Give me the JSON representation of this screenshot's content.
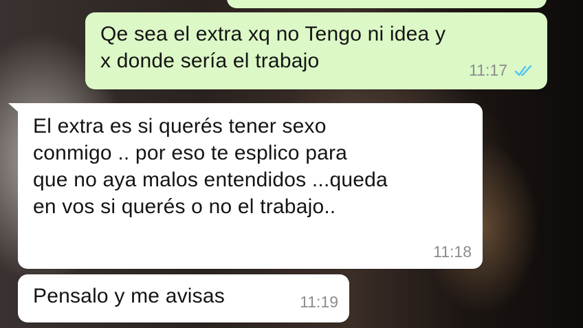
{
  "conversation": {
    "messages": [
      {
        "direction": "outgoing",
        "text": "",
        "time": ""
      },
      {
        "direction": "outgoing",
        "text": "Qe sea el extra xq no Tengo ni idea y\nx donde sería el trabajo",
        "time": "11:17",
        "status_icon": "double-check-read-icon",
        "status_color": "#4fc3f7"
      },
      {
        "direction": "incoming",
        "text": "El extra es si querés tener sexo\nconmigo .. por eso te esplico para\nque no aya malos entendidos ...queda\nen vos si querés o no el trabajo..",
        "time": "11:18"
      },
      {
        "direction": "incoming",
        "text": "Pensalo y me avisas",
        "time": "11:19"
      }
    ]
  },
  "colors": {
    "outgoing_bubble": "#dcf8c6",
    "incoming_bubble": "#ffffff",
    "timestamp": "#8c8c8c"
  }
}
